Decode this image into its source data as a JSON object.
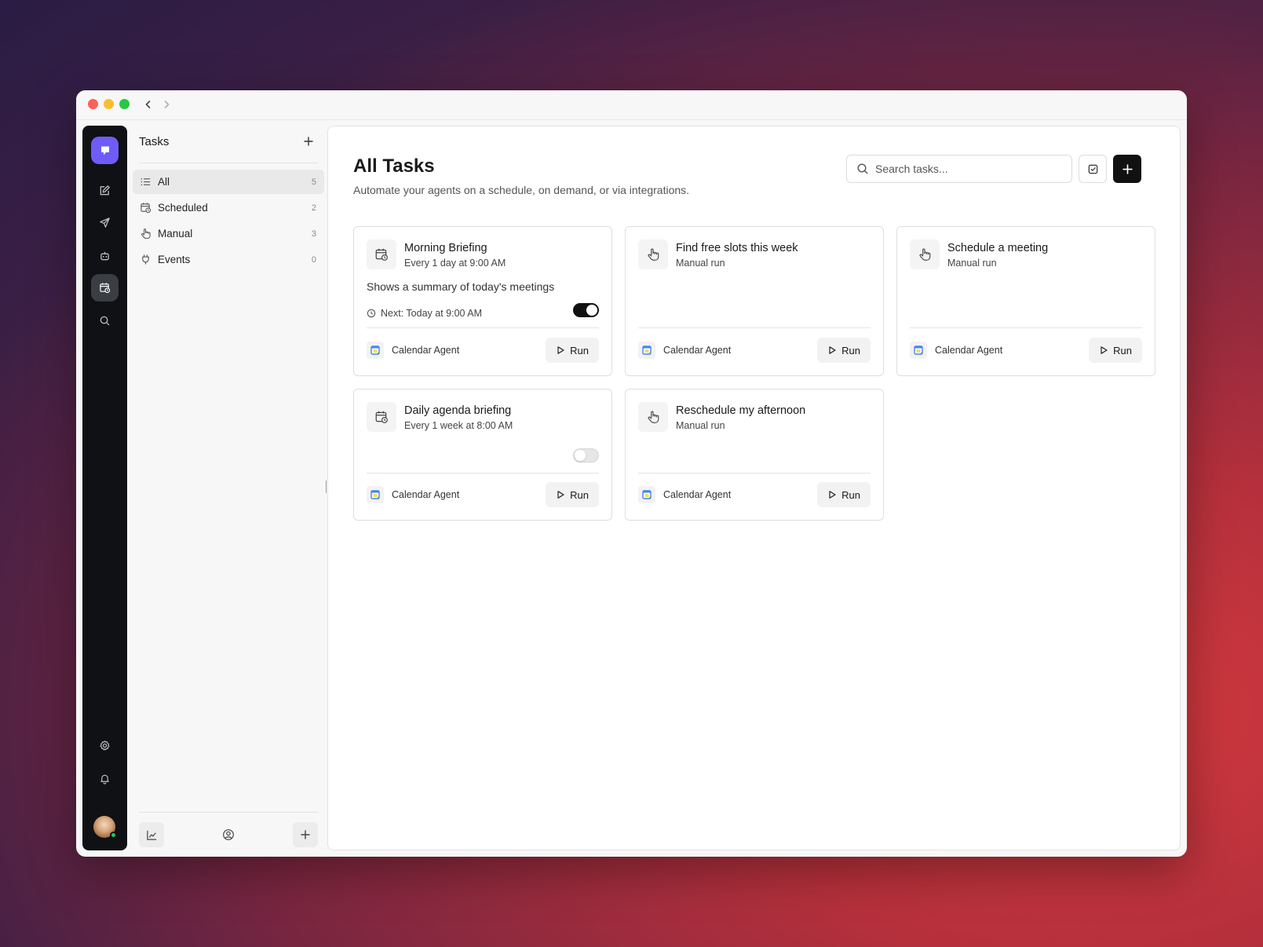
{
  "window": {
    "traffic_lights": [
      "close",
      "minimize",
      "maximize"
    ],
    "nav": {
      "back_icon": "chevron-left-icon",
      "forward_icon": "chevron-right-icon"
    }
  },
  "rail": {
    "logo_icon": "chat-bubble-icon",
    "items": [
      {
        "icon": "edit-icon",
        "active": false
      },
      {
        "icon": "send-icon",
        "active": false
      },
      {
        "icon": "robot-icon",
        "active": false
      },
      {
        "icon": "calendar-clock-icon",
        "active": true
      },
      {
        "icon": "search-icon",
        "active": false
      }
    ],
    "bottom_items": [
      {
        "icon": "gear-icon"
      },
      {
        "icon": "bell-icon"
      }
    ],
    "avatar_status": "online"
  },
  "sidebar": {
    "title": "Tasks",
    "items": [
      {
        "label": "All",
        "count": "5",
        "icon": "list-icon",
        "active": true
      },
      {
        "label": "Scheduled",
        "count": "2",
        "icon": "calendar-clock-icon",
        "active": false
      },
      {
        "label": "Manual",
        "count": "3",
        "icon": "hand-pointer-icon",
        "active": false
      },
      {
        "label": "Events",
        "count": "0",
        "icon": "plug-icon",
        "active": false
      }
    ],
    "footer_icons": [
      "chart-icon",
      "user-circle-icon",
      "plus-icon"
    ]
  },
  "main": {
    "title": "All Tasks",
    "subtitle": "Automate your agents on a schedule, on demand, or via integrations.",
    "search_placeholder": "Search tasks..."
  },
  "cards": [
    {
      "title": "Morning Briefing",
      "subtitle": "Every 1 day at 9:00 AM",
      "icon": "calendar-clock-icon",
      "description": "Shows a summary of today's meetings",
      "next": "Next: Today at 9:00 AM",
      "toggle": true,
      "agent": "Calendar Agent",
      "run_label": "Run"
    },
    {
      "title": "Find free slots this week",
      "subtitle": "Manual run",
      "icon": "hand-pointer-icon",
      "agent": "Calendar Agent",
      "run_label": "Run"
    },
    {
      "title": "Schedule a meeting",
      "subtitle": "Manual run",
      "icon": "hand-pointer-icon",
      "agent": "Calendar Agent",
      "run_label": "Run"
    },
    {
      "title": "Daily agenda briefing",
      "subtitle": "Every 1 week at 8:00 AM",
      "icon": "calendar-clock-icon",
      "toggle": false,
      "agent": "Calendar Agent",
      "run_label": "Run"
    },
    {
      "title": "Reschedule my afternoon",
      "subtitle": "Manual run",
      "icon": "hand-pointer-icon",
      "agent": "Calendar Agent",
      "run_label": "Run"
    }
  ],
  "colors": {
    "accent": "#6e5cf6",
    "rail_bg": "#0f1114",
    "primary_button": "#111111",
    "online": "#22c55e"
  }
}
